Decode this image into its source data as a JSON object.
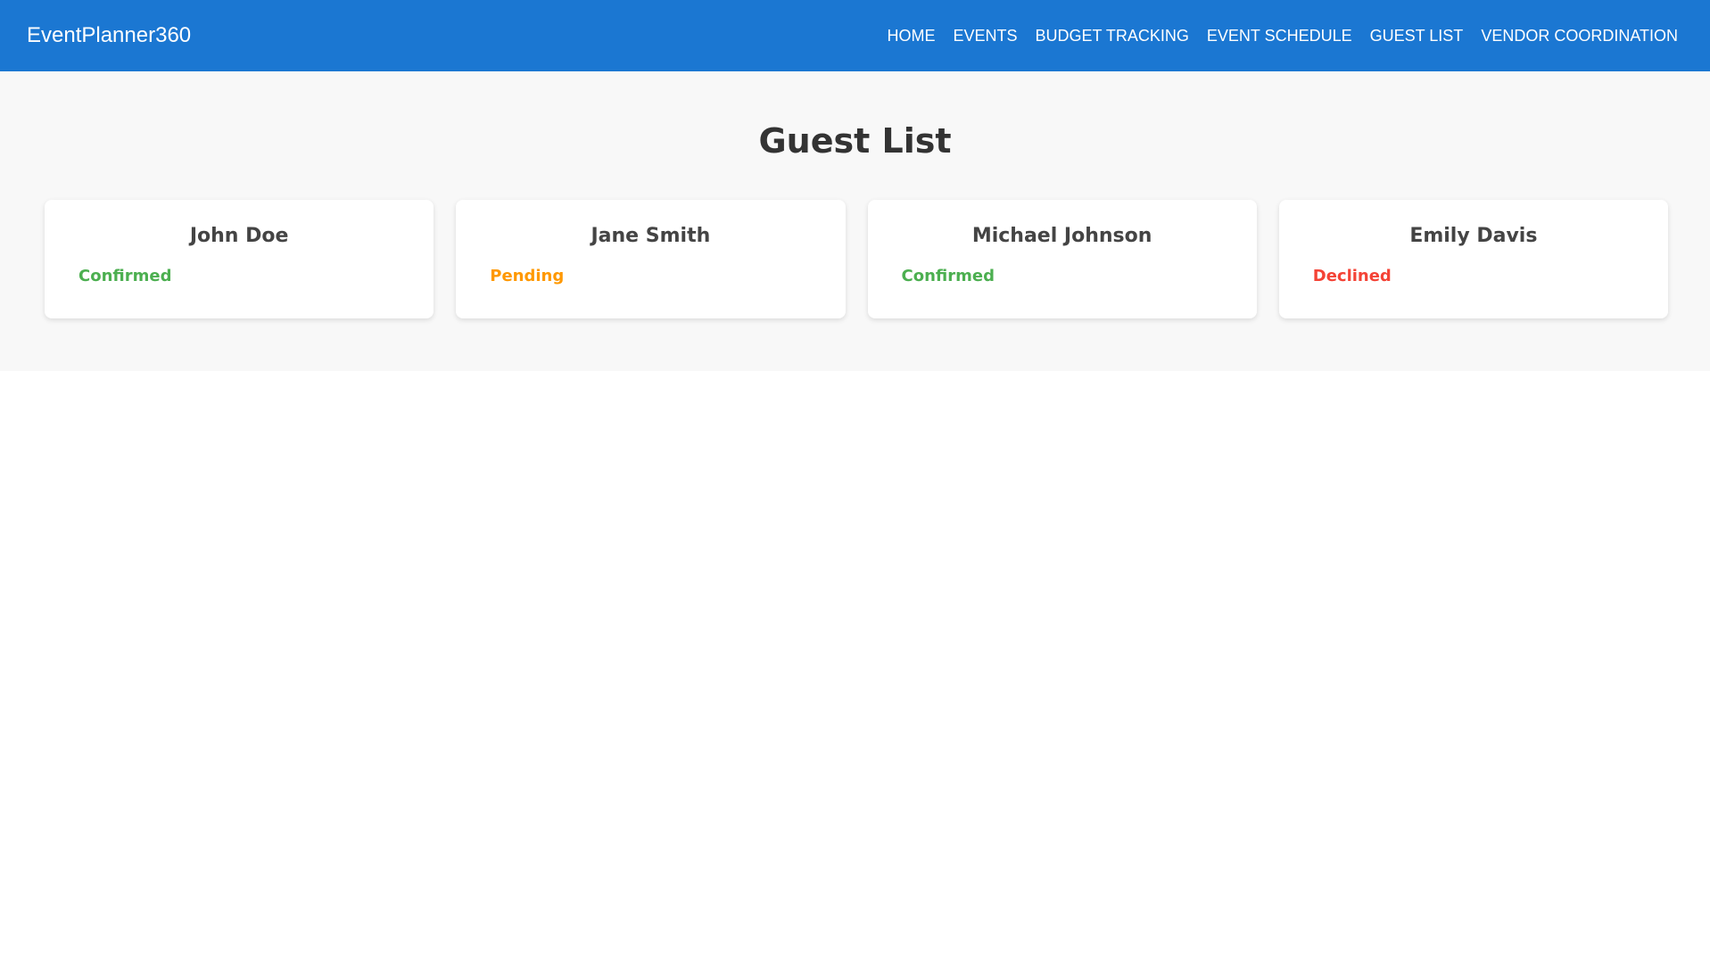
{
  "app": {
    "brand": "EventPlanner360"
  },
  "nav": {
    "items": [
      {
        "label": "HOME"
      },
      {
        "label": "EVENTS"
      },
      {
        "label": "BUDGET TRACKING"
      },
      {
        "label": "EVENT SCHEDULE"
      },
      {
        "label": "GUEST LIST"
      },
      {
        "label": "VENDOR COORDINATION"
      }
    ]
  },
  "colors": {
    "navbar": "#1b77d2",
    "confirmed": "#4caf50",
    "pending": "#ff9800",
    "declined": "#f44336"
  },
  "page": {
    "title": "Guest List"
  },
  "guests": [
    {
      "name": "John Doe",
      "status": "Confirmed",
      "status_color": "#4caf50"
    },
    {
      "name": "Jane Smith",
      "status": "Pending",
      "status_color": "#ff9800"
    },
    {
      "name": "Michael Johnson",
      "status": "Confirmed",
      "status_color": "#4caf50"
    },
    {
      "name": "Emily Davis",
      "status": "Declined",
      "status_color": "#f44336"
    }
  ]
}
